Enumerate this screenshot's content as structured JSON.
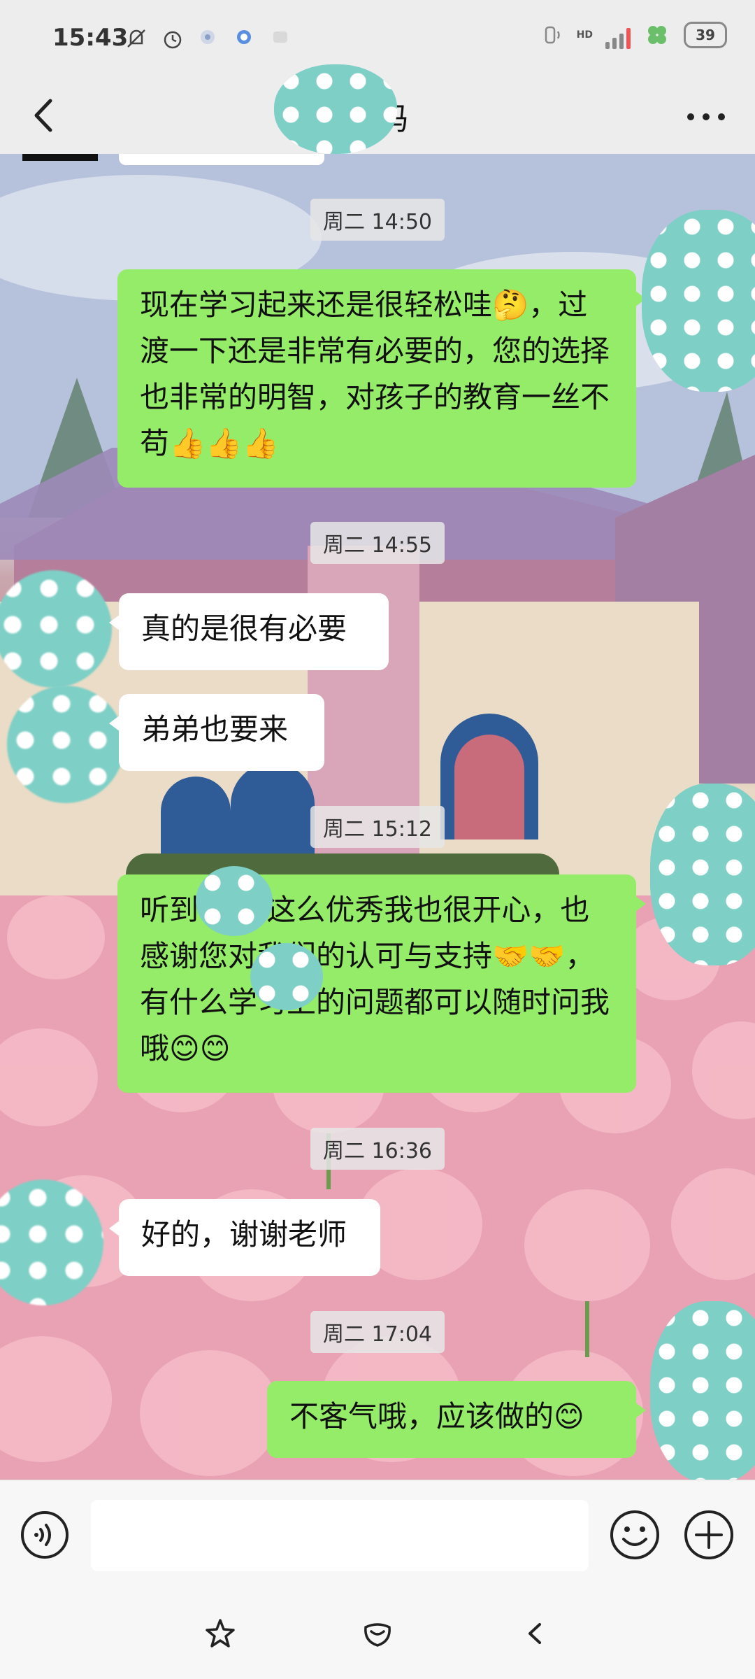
{
  "status_bar": {
    "time": "15:43",
    "battery": "39",
    "network": "HD"
  },
  "header": {
    "title": "妈妈"
  },
  "messages": [
    {
      "type": "time",
      "text": "周二 14:50"
    },
    {
      "type": "out",
      "text": "现在学习起来还是很轻松哇🤔，过渡一下还是非常有必要的，您的选择也非常的明智，对孩子的教育一丝不苟👍👍👍"
    },
    {
      "type": "time",
      "text": "周二 14:55"
    },
    {
      "type": "in",
      "text": "真的是很有必要"
    },
    {
      "type": "in",
      "text": "弟弟也要来"
    },
    {
      "type": "time",
      "text": "周二 15:12"
    },
    {
      "type": "out",
      "text": "听到 现在这么优秀我也很开心，也感谢您对我们的认可与支持🤝🤝， 有什么学习上的问题都可以随时问我哦😊😊"
    },
    {
      "type": "time",
      "text": "周二 16:36"
    },
    {
      "type": "in",
      "text": "好的，谢谢老师"
    },
    {
      "type": "time",
      "text": "周二 17:04"
    },
    {
      "type": "out",
      "text": "不客气哦，应该做的😊"
    }
  ]
}
